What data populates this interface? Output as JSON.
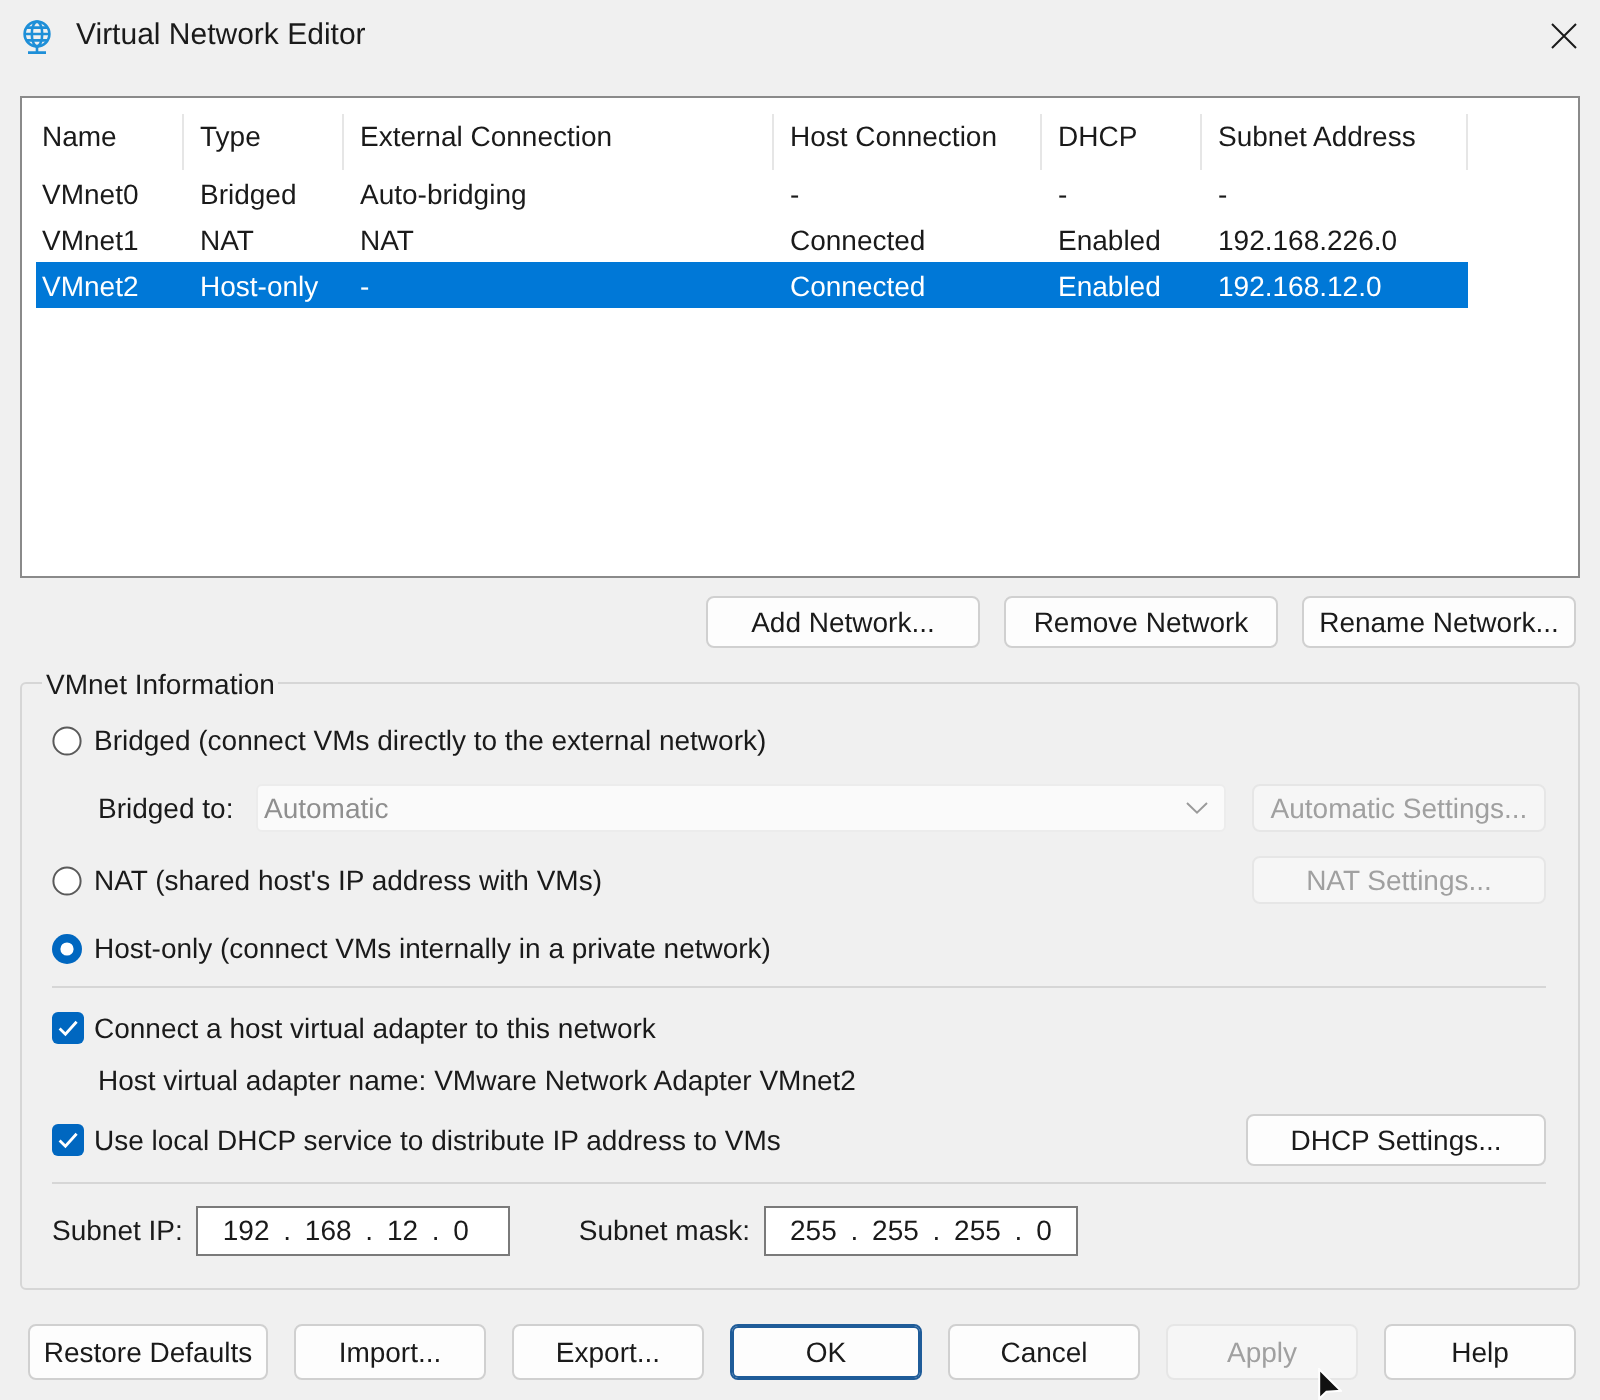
{
  "window": {
    "title": "Virtual Network Editor"
  },
  "networks": {
    "columns": [
      "Name",
      "Type",
      "External Connection",
      "Host Connection",
      "DHCP",
      "Subnet Address"
    ],
    "rows": [
      {
        "cells": [
          "VMnet0",
          "Bridged",
          "Auto-bridging",
          "-",
          "-",
          "-"
        ],
        "selected": false
      },
      {
        "cells": [
          "VMnet1",
          "NAT",
          "NAT",
          "Connected",
          "Enabled",
          "192.168.226.0"
        ],
        "selected": false
      },
      {
        "cells": [
          "VMnet2",
          "Host-only",
          "-",
          "Connected",
          "Enabled",
          "192.168.12.0"
        ],
        "selected": true
      }
    ]
  },
  "network_buttons": [
    {
      "label": "Add Network..."
    },
    {
      "label": "Remove Network"
    },
    {
      "label": "Rename Network..."
    }
  ],
  "vmnet_information": {
    "title": "VMnet Information",
    "connection_types": [
      {
        "label": "Bridged (connect VMs directly to the external network)",
        "selected": false
      },
      {
        "label": "NAT (shared host's IP address with VMs)",
        "selected": false
      },
      {
        "label": "Host-only (connect VMs internally in a private network)",
        "selected": true
      }
    ],
    "bridged_to": {
      "label": "Bridged to:",
      "value": "Automatic",
      "disabled": true
    },
    "automatic_settings_button": {
      "label": "Automatic Settings...",
      "disabled": true
    },
    "nat_settings_button": {
      "label": "NAT Settings...",
      "disabled": true
    },
    "host_adapter": {
      "label": "Connect a host virtual adapter to this network",
      "checked": true
    },
    "adapter_name": "Host virtual adapter name: VMware Network Adapter VMnet2",
    "local_dhcp": {
      "label": "Use local DHCP service to distribute IP address to VMs",
      "checked": true
    },
    "dhcp_settings_button": {
      "label": "DHCP Settings...",
      "disabled": false
    },
    "subnet_ip": {
      "label": "Subnet IP:",
      "value": "192 . 168 . 12 . 0"
    },
    "subnet_mask": {
      "label": "Subnet mask:",
      "value": "255 . 255 . 255 . 0"
    }
  },
  "dialog_buttons": [
    {
      "label": "Restore Defaults",
      "disabled": false,
      "default": false
    },
    {
      "label": "Import...",
      "disabled": false,
      "default": false
    },
    {
      "label": "Export...",
      "disabled": false,
      "default": false
    },
    {
      "label": "OK",
      "disabled": false,
      "default": true
    },
    {
      "label": "Cancel",
      "disabled": false,
      "default": false
    },
    {
      "label": "Apply",
      "disabled": true,
      "default": false
    },
    {
      "label": "Help",
      "disabled": false,
      "default": false
    }
  ]
}
